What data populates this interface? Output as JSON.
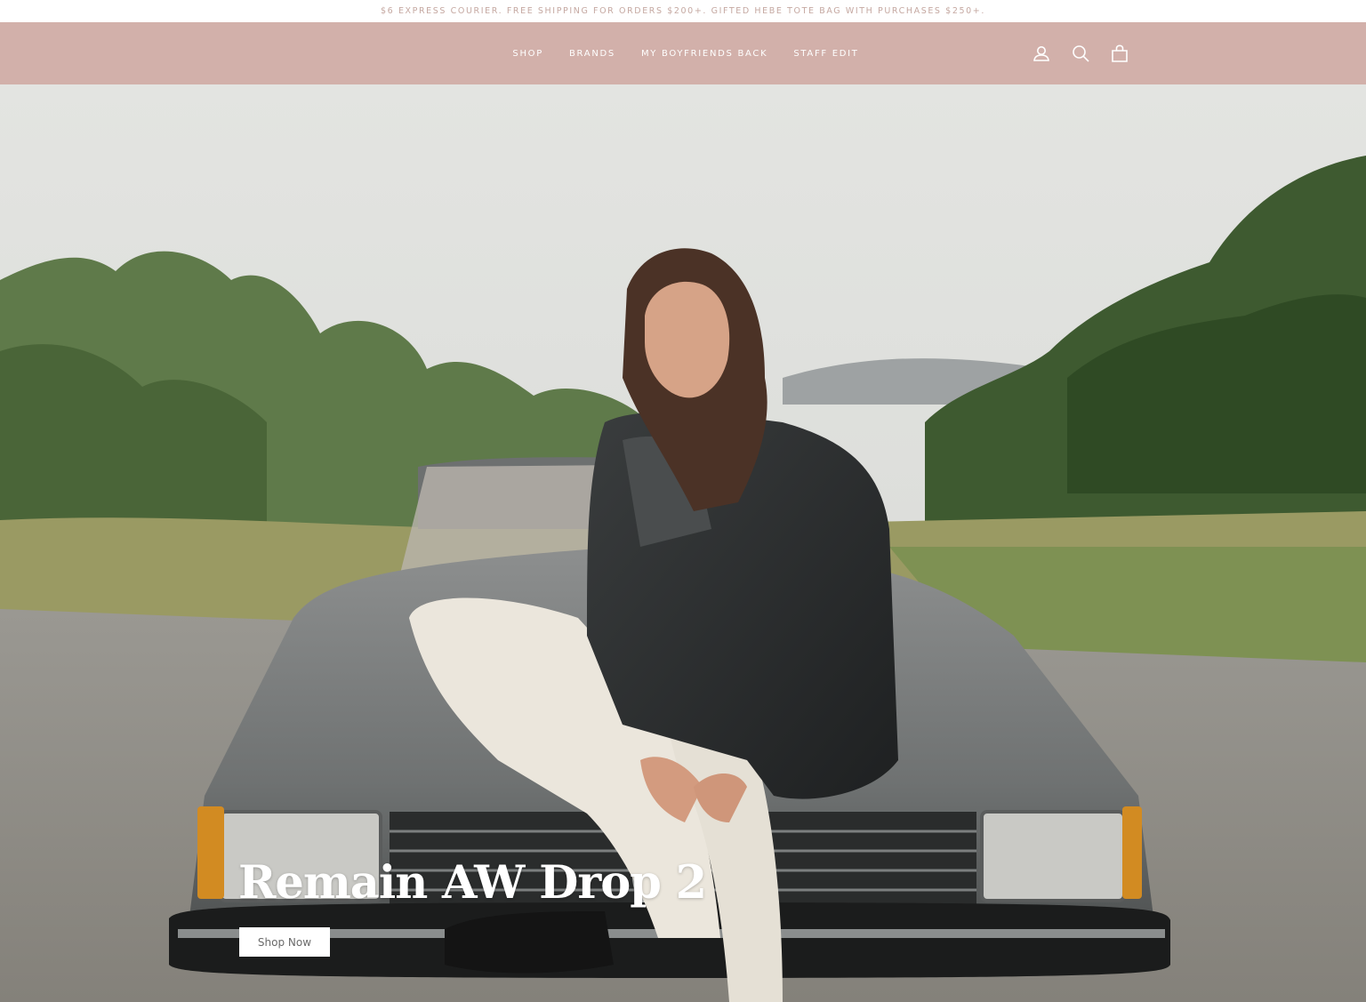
{
  "announcement": {
    "text": "$6 EXPRESS COURIER. FREE SHIPPING FOR ORDERS $200+. GIFTED HEBE TOTE BAG WITH PURCHASES $250+."
  },
  "header": {
    "background": "#d2b0aa",
    "nav": [
      {
        "label": "SHOP"
      },
      {
        "label": "BRANDS"
      },
      {
        "label": "MY BOYFRIENDS BACK"
      },
      {
        "label": "STAFF EDIT"
      }
    ],
    "icons": [
      "account-icon",
      "search-icon",
      "cart-icon"
    ]
  },
  "hero": {
    "title": "Remain AW Drop 2",
    "button_label": "Shop Now"
  },
  "colors": {
    "accent": "#d2b0aa",
    "announcement_text": "#c5a8a1",
    "hero_text": "#ffffff"
  }
}
